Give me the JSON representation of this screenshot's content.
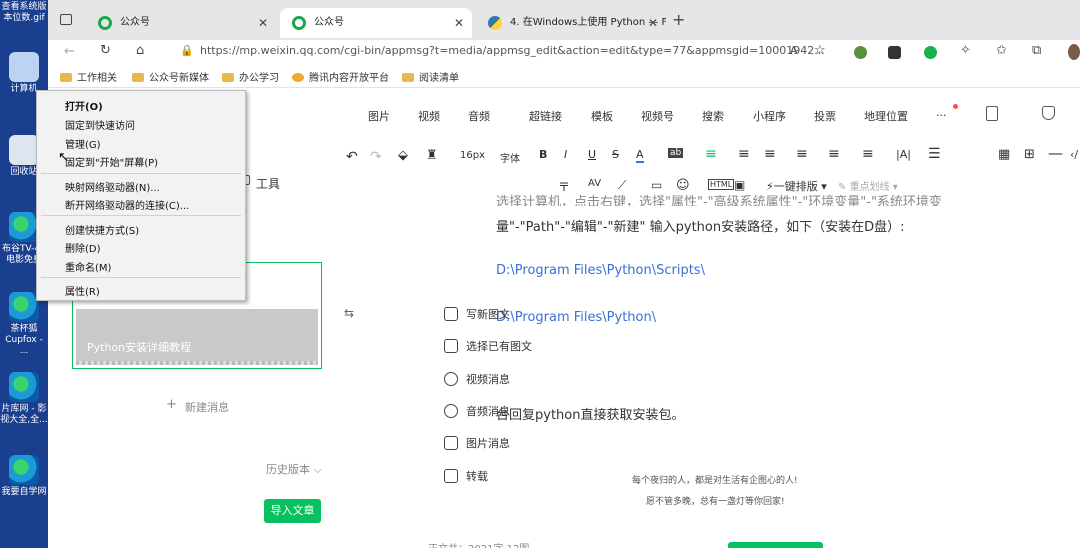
{
  "desktop": {
    "icons": [
      {
        "label": "查看系统版本位数.gif"
      },
      {
        "label": "计算机"
      },
      {
        "label": "回收站"
      },
      {
        "label": "布谷TV-4K电影免费"
      },
      {
        "label": "茶杯狐Cupfox - ..."
      },
      {
        "label": "片库网 - 影视大全,全..."
      },
      {
        "label": "我要自学网"
      }
    ]
  },
  "browser": {
    "tabs": [
      {
        "title": "公众号"
      },
      {
        "title": "公众号"
      },
      {
        "title": "4. 在Windows上使用 Python — F"
      }
    ],
    "url": "https://mp.weixin.qq.com/cgi-bin/appmsg?t=media/appmsg_edit&action=edit&type=77&appmsgid=10001942...",
    "bookmarks": [
      "工作相关",
      "公众号新媒体",
      "办公学习",
      "腾讯内容开放平台",
      "阅读清单"
    ]
  },
  "editor": {
    "insert_toolbar": [
      "图片",
      "视频",
      "音频",
      "超链接",
      "模板",
      "视频号",
      "搜索",
      "小程序",
      "投票",
      "地理位置",
      "..."
    ],
    "font_size": "16px",
    "font_family": "字体",
    "one_click_layout": "一键排版",
    "key_points": "重点划线",
    "tools_label": "工具",
    "content": {
      "line0": "选择计算机，点击右键，选择\"属性\"-\"高级系统属性\"-\"环境变量\"-\"系统环境变",
      "line1": "量\"-\"Path\"-\"编辑\"-\"新建\" 输入python安装路径，如下（安装在D盘）:",
      "path1": "D:\\Program Files\\Python\\Scripts\\",
      "path2": "D:\\Program Files\\Python\\",
      "reply_line": "台回复python直接获取安装包。",
      "quote1": "每个夜归的人，都是对生活有企图心的人!",
      "quote2": "愿不管多晚，总有一盏灯等你回家!",
      "footer": "正文共：2021字 12图"
    }
  },
  "article_list": {
    "card_title": "Python安装详细教程",
    "new_message": "新建消息",
    "history": "历史版本",
    "import_button": "导入文章"
  },
  "new_message_menu": [
    "写新图文",
    "选择已有图文",
    "视频消息",
    "音频消息",
    "图片消息",
    "转载"
  ],
  "context_menu": {
    "items": [
      "打开(O)",
      "固定到快速访问",
      "管理(G)",
      "固定到\"开始\"屏幕(P)",
      "映射网络驱动器(N)...",
      "断开网络驱动器的连接(C)...",
      "创建快捷方式(S)",
      "删除(D)",
      "重命名(M)",
      "属性(R)"
    ]
  },
  "colors": {
    "wechat_green": "#07c160",
    "link_blue": "#3a6fd8",
    "desktop_blue": "#1b3f8f"
  }
}
